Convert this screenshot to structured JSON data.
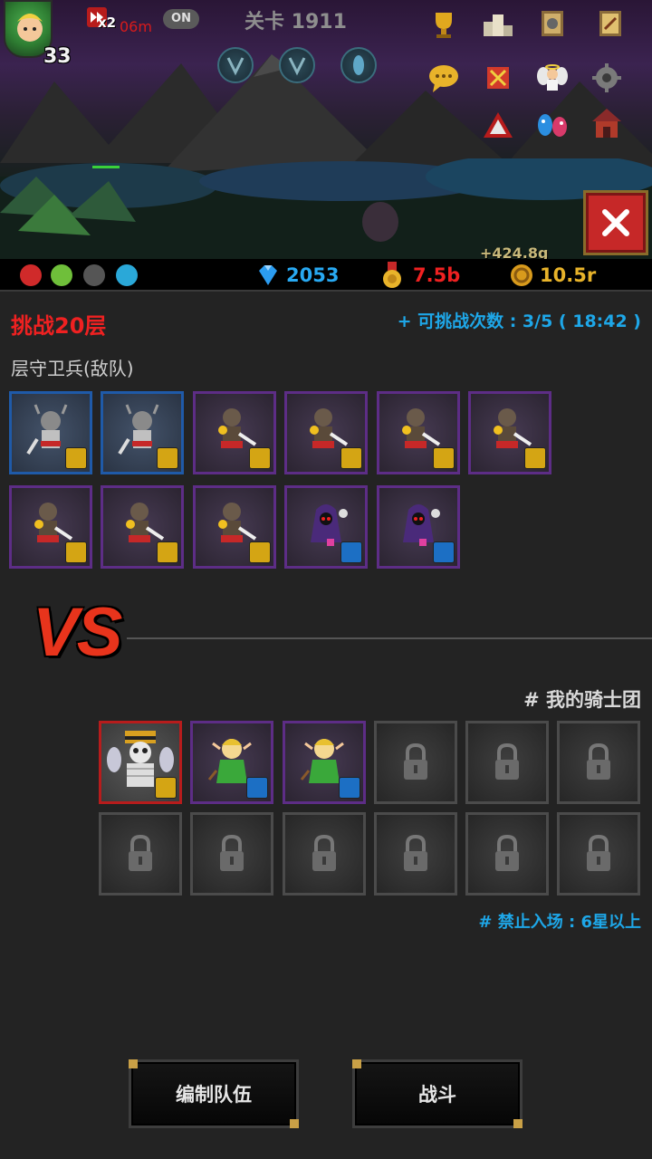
{
  "hud": {
    "player_level": "33",
    "speed_multiplier": "x2",
    "timer": "06m",
    "auto_toggle": "ON",
    "stage_title": "关卡 1911",
    "gold_gain": "+424.8g"
  },
  "resources": {
    "gems": "2053",
    "medals": "7.5b",
    "coins": "10.5r"
  },
  "challenge": {
    "title": "挑战20层",
    "attempts": "+ 可挑战次数 : 3/5 ( 18:42 )",
    "guard_label": "层守卫兵(敌队)",
    "enemies": [
      {
        "unit": "horned-knight",
        "rarity": "blue",
        "class": "sword-icon"
      },
      {
        "unit": "horned-knight",
        "rarity": "blue",
        "class": "sword-icon"
      },
      {
        "unit": "mace-warrior",
        "rarity": "purple",
        "class": "sword-icon"
      },
      {
        "unit": "mace-warrior",
        "rarity": "purple",
        "class": "sword-icon"
      },
      {
        "unit": "mace-warrior",
        "rarity": "purple",
        "class": "sword-icon"
      },
      {
        "unit": "mace-warrior",
        "rarity": "purple",
        "class": "sword-icon"
      },
      {
        "unit": "mace-warrior",
        "rarity": "purple",
        "class": "sword-icon"
      },
      {
        "unit": "mace-warrior",
        "rarity": "purple",
        "class": "sword-icon"
      },
      {
        "unit": "mace-warrior",
        "rarity": "purple",
        "class": "sword-icon"
      },
      {
        "unit": "hooded-necromancer",
        "rarity": "purple",
        "class": "staff-icon"
      },
      {
        "unit": "hooded-necromancer",
        "rarity": "purple",
        "class": "staff-icon"
      }
    ]
  },
  "vs_label": "VS",
  "my_team": {
    "label": "# 我的骑士团",
    "members": [
      {
        "unit": "mummy-pharaoh",
        "rarity": "red",
        "class": "sword-icon"
      },
      {
        "unit": "elf-archer",
        "rarity": "purple",
        "class": "staff-icon"
      },
      {
        "unit": "elf-archer",
        "rarity": "purple",
        "class": "staff-icon"
      }
    ],
    "locked_slots": 9,
    "ban_note": "# 禁止入场 : 6星以上"
  },
  "buttons": {
    "edit_team": "编制队伍",
    "battle": "战斗"
  },
  "colors": {
    "challenge_red": "#ef2121",
    "info_blue": "#1ea7e8",
    "gold": "#d4a514"
  }
}
